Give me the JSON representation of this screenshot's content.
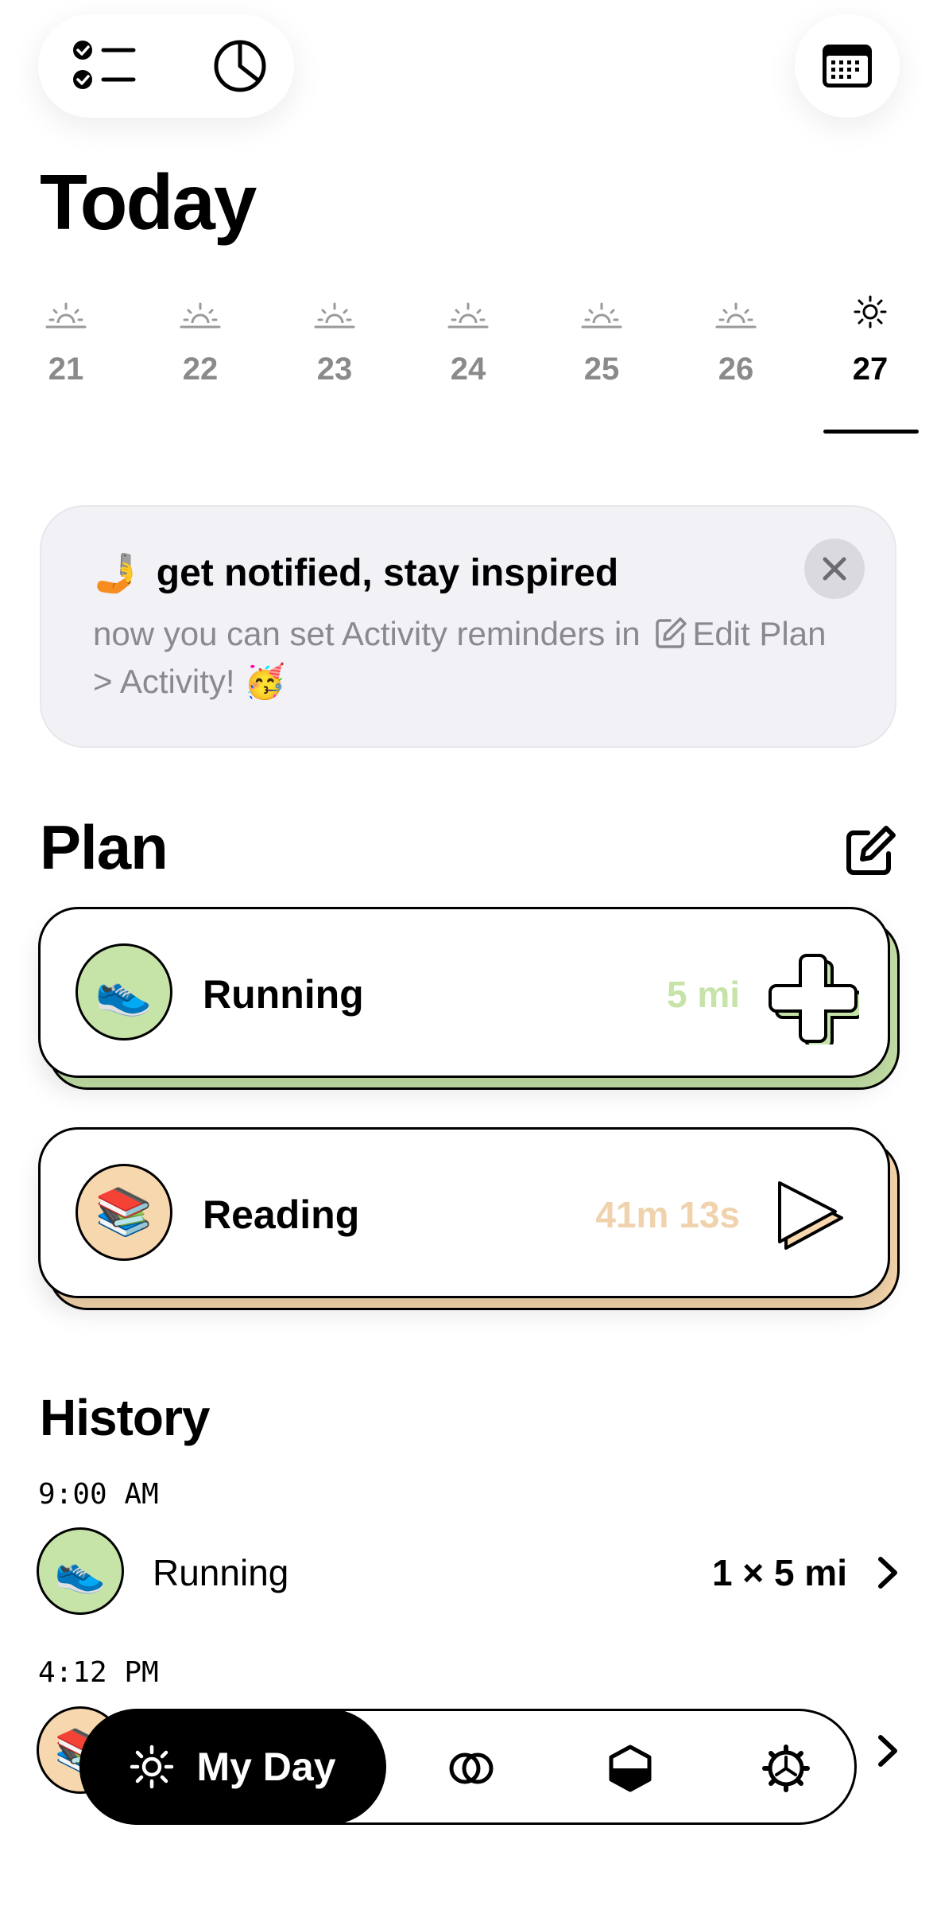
{
  "header": {
    "title": "Today"
  },
  "days": [
    {
      "num": "21",
      "active": false
    },
    {
      "num": "22",
      "active": false
    },
    {
      "num": "23",
      "active": false
    },
    {
      "num": "24",
      "active": false
    },
    {
      "num": "25",
      "active": false
    },
    {
      "num": "26",
      "active": false
    },
    {
      "num": "27",
      "active": true
    }
  ],
  "banner": {
    "emoji": "🤳",
    "title": "get notified, stay inspired",
    "body_pre": "now you can set Activity reminders in",
    "body_link": "Edit",
    "body_post": "Plan > Activity!",
    "body_emoji": "🥳"
  },
  "plan": {
    "title": "Plan",
    "items": [
      {
        "label": "Running",
        "value": "5 mi",
        "emoji": "👟",
        "color": "#c6e3a8",
        "value_color": "#c6e3a8",
        "action": "plus-icon"
      },
      {
        "label": "Reading",
        "value": "41m 13s",
        "emoji": "📚",
        "color": "#f7d7ad",
        "value_color": "#f0d2ac",
        "action": "play-icon"
      }
    ]
  },
  "history": {
    "title": "History",
    "entries": [
      {
        "time": "9:00 AM",
        "label": "Running",
        "value": "1 × 5 mi",
        "emoji": "👟",
        "color": "#c6e3a8"
      },
      {
        "time": "4:12 PM",
        "label": "",
        "value": "",
        "emoji": "📚",
        "color": "#f7d7ad"
      }
    ]
  },
  "tabbar": {
    "active_label": "My Day",
    "tabs": [
      "sun-icon",
      "circles-icon",
      "hexagon-icon",
      "gear-icon"
    ]
  }
}
